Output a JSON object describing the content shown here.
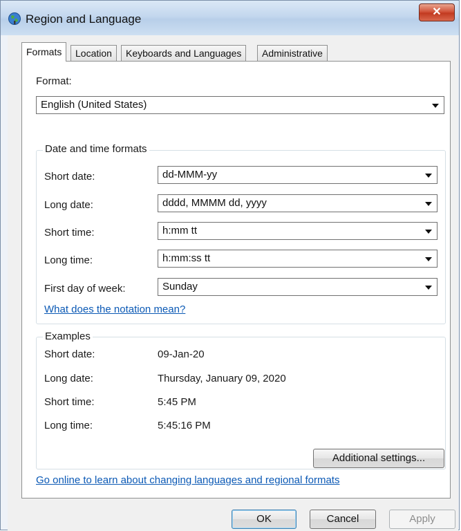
{
  "window": {
    "title": "Region and Language",
    "close_symbol": "✕"
  },
  "tabs": [
    {
      "label": "Formats",
      "active": true
    },
    {
      "label": "Location",
      "active": false
    },
    {
      "label": "Keyboards and Languages",
      "active": false
    },
    {
      "label": "Administrative",
      "active": false
    }
  ],
  "formats": {
    "format_label": "Format:",
    "format_value": "English (United States)"
  },
  "date_time": {
    "legend": "Date and time formats",
    "rows": [
      {
        "label": "Short date:",
        "value": "dd-MMM-yy"
      },
      {
        "label": "Long date:",
        "value": "dddd, MMMM dd, yyyy"
      },
      {
        "label": "Short time:",
        "value": "h:mm tt"
      },
      {
        "label": "Long time:",
        "value": "h:mm:ss tt"
      },
      {
        "label": "First day of week:",
        "value": "Sunday"
      }
    ],
    "notation_link": "What does the notation mean?"
  },
  "examples": {
    "legend": "Examples",
    "rows": [
      {
        "label": "Short date:",
        "value": "09-Jan-20"
      },
      {
        "label": "Long date:",
        "value": "Thursday, January 09, 2020"
      },
      {
        "label": "Short time:",
        "value": "5:45 PM"
      },
      {
        "label": "Long time:",
        "value": "5:45:16 PM"
      }
    ]
  },
  "additional_settings_label": "Additional settings...",
  "online_link": "Go online to learn about changing languages and regional formats",
  "buttons": {
    "ok": "OK",
    "cancel": "Cancel",
    "apply": "Apply"
  },
  "icons": {
    "app": "globe-icon",
    "close": "close-icon",
    "dropdown": "chevron-down-icon"
  },
  "colors": {
    "link": "#0b59b5",
    "close_button": "#c23a20"
  }
}
